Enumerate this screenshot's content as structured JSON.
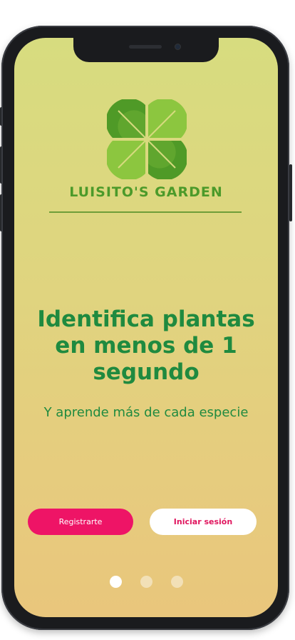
{
  "brand": {
    "name": "LUISITO'S GARDEN",
    "logo_icon": "four-leaf-clover-icon",
    "logo_colors": [
      "#4f9a27",
      "#8cc63f"
    ]
  },
  "onboarding": {
    "headline": "Identifica plantas en menos de 1 segundo",
    "subtitle": "Y aprende más de cada especie"
  },
  "actions": {
    "register_label": "Registrarte",
    "login_label": "Iniciar sesión"
  },
  "pagination": {
    "total_pages": 3,
    "current_page": 1
  },
  "colors": {
    "accent": "#ee1466",
    "text_green": "#1f8a3f",
    "brand_green": "#4c9a2a"
  }
}
